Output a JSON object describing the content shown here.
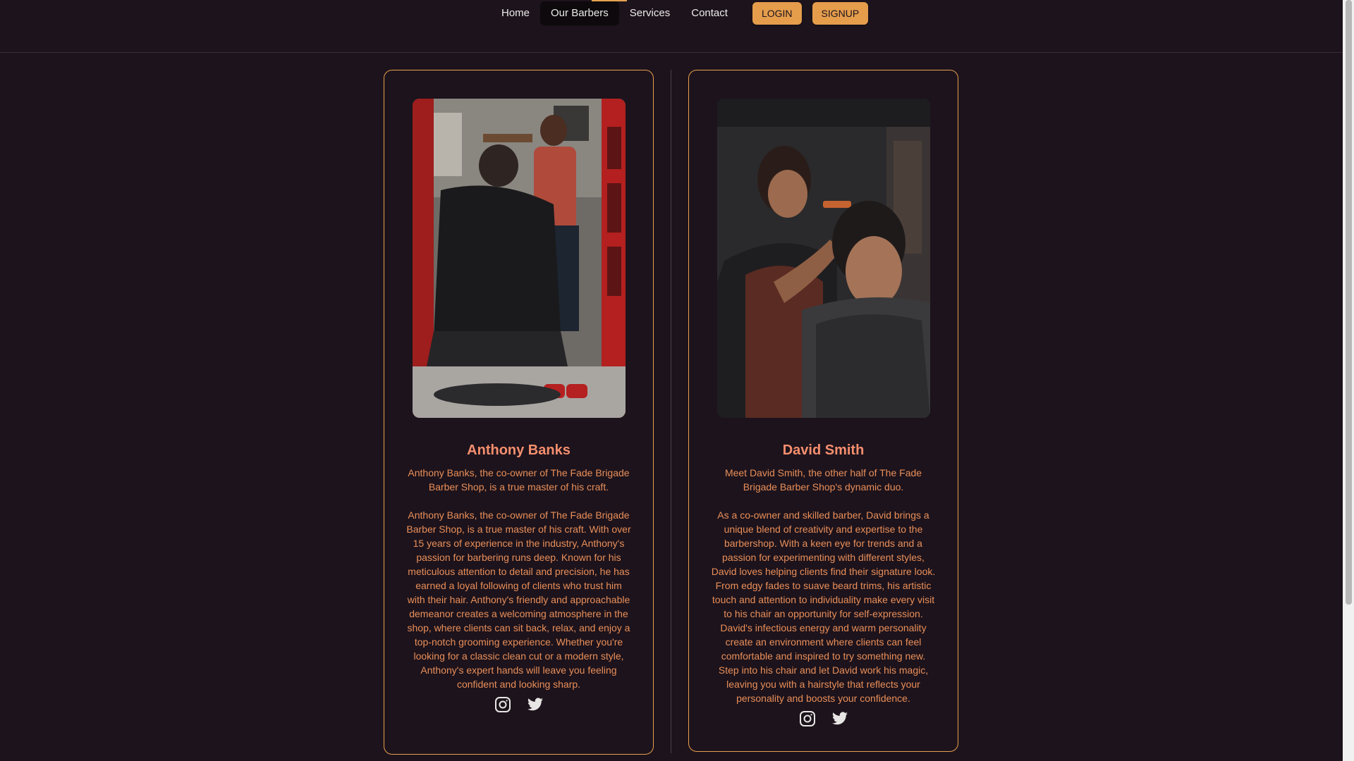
{
  "nav": {
    "links": [
      {
        "label": "Home"
      },
      {
        "label": "Our Barbers"
      },
      {
        "label": "Services"
      },
      {
        "label": "Contact"
      }
    ],
    "active_index": 1,
    "login_label": "LOGIN",
    "signup_label": "SIGNUP"
  },
  "barbers": [
    {
      "name": "Anthony Banks",
      "intro": "Anthony Banks, the co-owner of The Fade Brigade Barber Shop, is a true master of his craft.",
      "bio": "Anthony Banks, the co-owner of The Fade Brigade Barber Shop, is a true master of his craft. With over 15 years of experience in the industry, Anthony's passion for barbering runs deep. Known for his meticulous attention to detail and precision, he has earned a loyal following of clients who trust him with their hair. Anthony's friendly and approachable demeanor creates a welcoming atmosphere in the shop, where clients can sit back, relax, and enjoy a top-notch grooming experience. Whether you're looking for a classic clean cut or a modern style, Anthony's expert hands will leave you feeling confident and looking sharp.",
      "socials": [
        "instagram-icon",
        "twitter-icon"
      ]
    },
    {
      "name": "David Smith",
      "intro": "Meet David Smith, the other half of The Fade Brigade Barber Shop's dynamic duo.",
      "bio": "As a co-owner and skilled barber, David brings a unique blend of creativity and expertise to the barbershop. With a keen eye for trends and a passion for experimenting with different styles, David loves helping clients find their signature look. From edgy fades to suave beard trims, his artistic touch and attention to individuality make every visit to his chair an opportunity for self-expression. David's infectious energy and warm personality create an environment where clients can feel comfortable and inspired to try something new. Step into his chair and let David work his magic, leaving you with a hairstyle that reflects your personality and boosts your confidence.",
      "socials": [
        "instagram-icon",
        "twitter-icon"
      ]
    }
  ],
  "colors": {
    "background": "#1d131c",
    "accent": "#e59d4c",
    "name": "#f58f6e",
    "text": "#e98f59"
  }
}
